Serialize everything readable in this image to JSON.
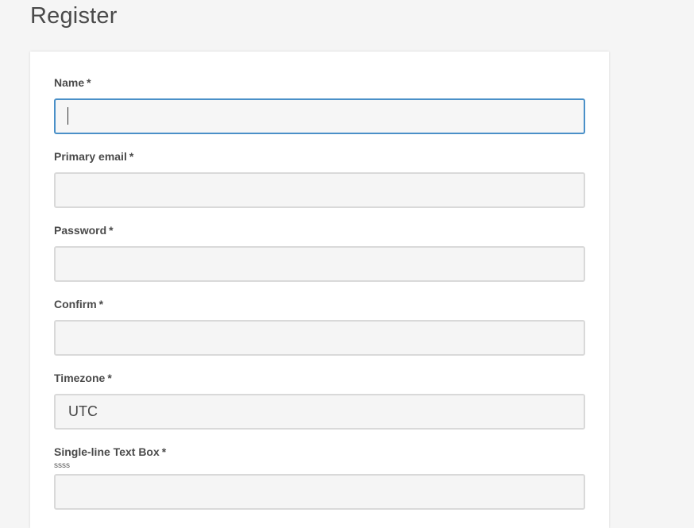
{
  "page": {
    "title": "Register"
  },
  "form": {
    "required_marker": "*",
    "fields": [
      {
        "label": "Name",
        "value": "",
        "focused": true
      },
      {
        "label": "Primary email",
        "value": ""
      },
      {
        "label": "Password",
        "value": ""
      },
      {
        "label": "Confirm",
        "value": ""
      },
      {
        "label": "Timezone",
        "value": "UTC"
      },
      {
        "label": "Single-line Text Box",
        "hint": "ssss",
        "value": ""
      }
    ]
  },
  "colors": {
    "focus_border": "#4a90c8",
    "input_bg": "#f5f5f5",
    "page_bg": "#f5f5f5"
  }
}
